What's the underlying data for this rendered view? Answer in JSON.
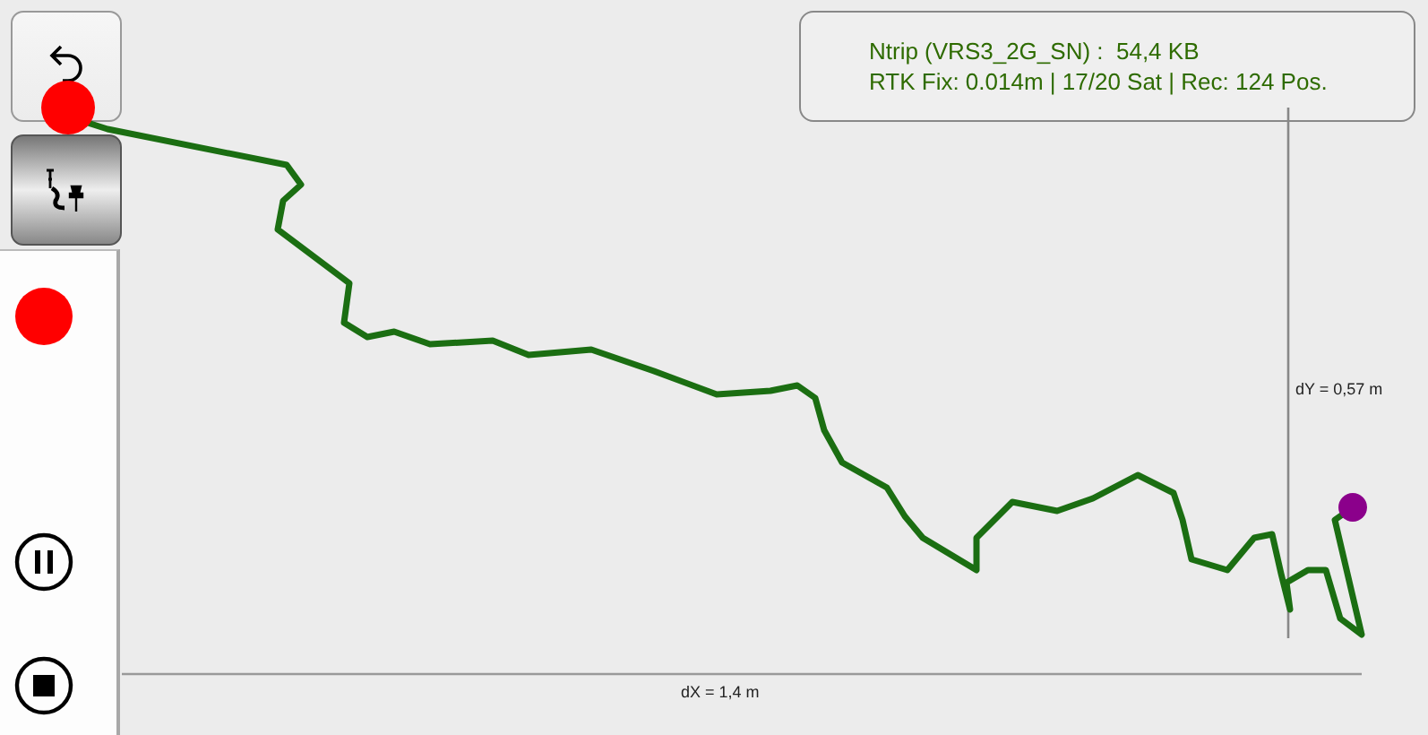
{
  "toolbar": [
    {
      "kind": "undo",
      "pressed": false
    },
    {
      "kind": "track",
      "pressed": true
    }
  ],
  "recorder": [
    {
      "kind": "record"
    },
    {
      "kind": "pause"
    },
    {
      "kind": "stop"
    }
  ],
  "status": {
    "lines": [
      "Ntrip (VRS3_2G_SN) :  54,4 KB",
      "RTK Fix: 0.014m | 17/20 Sat | Rec: 124 Pos."
    ]
  },
  "map": {
    "dx_label": "dX = 1,4 m",
    "dy_label": "dY = 0,57 m"
  }
}
